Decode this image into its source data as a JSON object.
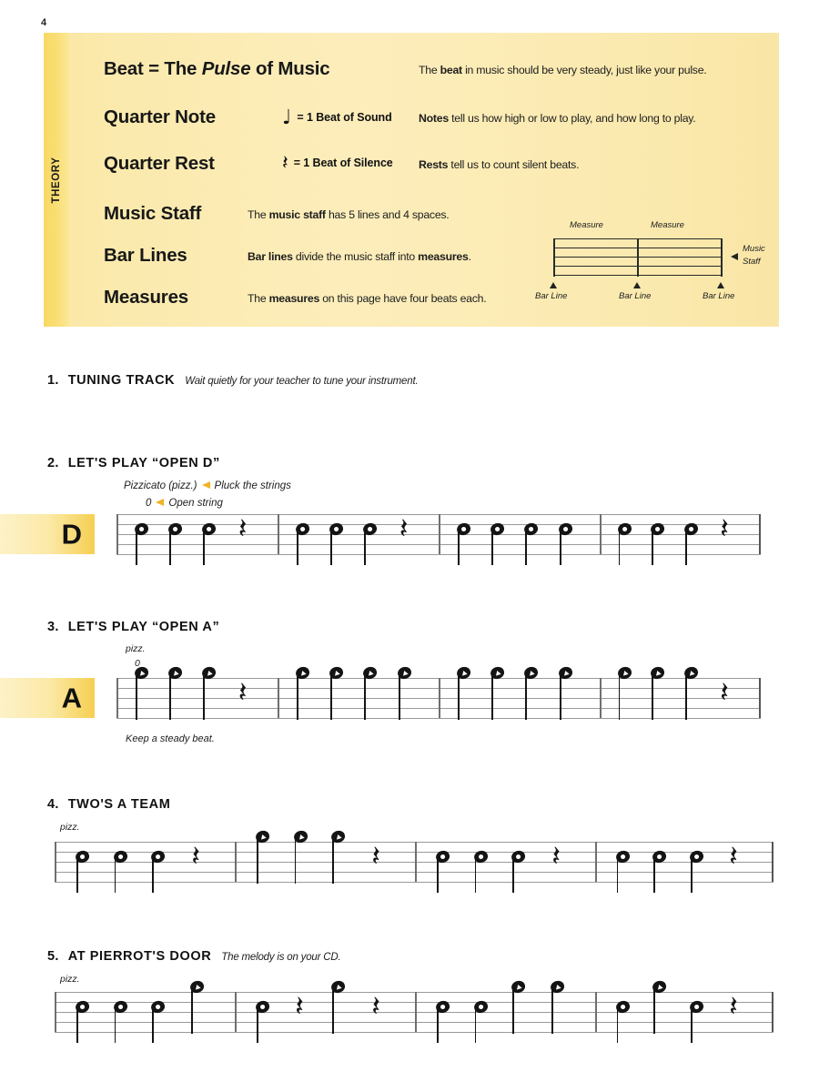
{
  "page": {
    "number": "4",
    "theory_tab_label": "THEORY"
  },
  "theory": {
    "rows": [
      {
        "term": "Beat = The ",
        "term_italic": "Pulse",
        "term_tail": " of Music",
        "symbol_glyph": "",
        "symbol_text": "",
        "desc_pre": "The ",
        "desc_bold": "beat",
        "desc_post": " in music should be very steady, just like your pulse."
      },
      {
        "term": "Quarter Note",
        "term_italic": "",
        "term_tail": "",
        "symbol_glyph": "♩",
        "symbol_text": "= 1 Beat of Sound",
        "desc_pre": "",
        "desc_bold": "Notes",
        "desc_post": " tell us how high or low to play, and how long to play."
      },
      {
        "term": "Quarter Rest",
        "term_italic": "",
        "term_tail": "",
        "symbol_glyph": "𝄽",
        "symbol_text": "= 1 Beat of Silence",
        "desc_pre": "",
        "desc_bold": "Rests",
        "desc_post": " tell us to count silent beats."
      },
      {
        "term": "Music Staff",
        "term_italic": "",
        "term_tail": "",
        "symbol_glyph": "",
        "symbol_text": "",
        "desc_pre": "The ",
        "desc_bold": "music staff",
        "desc_post": " has 5 lines and 4 spaces."
      },
      {
        "term": "Bar Lines",
        "term_italic": "",
        "term_tail": "",
        "symbol_glyph": "",
        "symbol_text": "",
        "desc_pre": "",
        "desc_bold": "Bar lines",
        "desc_post2_bold": "measures",
        "desc_post": " divide the music staff into "
      },
      {
        "term": "Measures",
        "term_italic": "",
        "term_tail": "",
        "symbol_glyph": "",
        "symbol_text": "",
        "desc_pre": "The ",
        "desc_bold": "measures",
        "desc_post": " on this page have four beats each."
      }
    ],
    "diagram": {
      "measure_label_left": "Measure",
      "measure_label_right": "Measure",
      "barline_labels": [
        "Bar Line",
        "Bar Line",
        "Bar Line"
      ],
      "staff_label_line1": "Music",
      "staff_label_line2": "Staff"
    }
  },
  "exercises": [
    {
      "number": "1.",
      "title": "TUNING TRACK",
      "subtitle": "Wait quietly for your teacher to tune your instrument."
    },
    {
      "number": "2.",
      "title": "LET'S PLAY “OPEN D”",
      "subtitle": "",
      "badge_letter": "D",
      "anno_pizz": "Pizzicato (pizz.)",
      "anno_pizz_tail": "Pluck the strings",
      "anno_open": "0",
      "anno_open_tail": "Open string",
      "below_note": ""
    },
    {
      "number": "3.",
      "title": "LET'S PLAY “OPEN A”",
      "subtitle": "",
      "badge_letter": "A",
      "anno_pizz": "pizz.",
      "anno_open": "0",
      "below_note": "Keep a steady beat."
    },
    {
      "number": "4.",
      "title": "TWO'S A TEAM",
      "subtitle": "",
      "anno_pizz": "pizz."
    },
    {
      "number": "5.",
      "title": "AT PIERROT'S DOOR",
      "subtitle": "The melody is on your CD.",
      "anno_pizz": "pizz."
    }
  ],
  "music": {
    "rest_glyph": "𝄽",
    "systems": [
      {
        "id": "ex2-system",
        "measures": [
          [
            "D",
            "D",
            "D",
            "R"
          ],
          [
            "D",
            "D",
            "D",
            "R"
          ],
          [
            "D",
            "D",
            "D",
            "D"
          ],
          [
            "D",
            "D",
            "D",
            "R"
          ]
        ]
      },
      {
        "id": "ex3-system",
        "measures": [
          [
            "A",
            "A",
            "A",
            "R"
          ],
          [
            "A",
            "A",
            "A",
            "A"
          ],
          [
            "A",
            "A",
            "A",
            "A"
          ],
          [
            "A",
            "A",
            "A",
            "R"
          ]
        ]
      },
      {
        "id": "ex4-system",
        "measures": [
          [
            "D",
            "D",
            "D",
            "R"
          ],
          [
            "A",
            "A",
            "A",
            "R"
          ],
          [
            "D",
            "D",
            "D",
            "R"
          ],
          [
            "D",
            "D",
            "D",
            "R"
          ]
        ]
      },
      {
        "id": "ex5-system",
        "measures": [
          [
            "D",
            "D",
            "D",
            "A"
          ],
          [
            "D",
            "R",
            "A",
            "R"
          ],
          [
            "D",
            "D",
            "A",
            "A"
          ],
          [
            "D",
            "A",
            "D",
            "R"
          ]
        ]
      }
    ]
  },
  "colors": {
    "theory_bg": "#fbeab0",
    "theory_tab": "#f7d964",
    "badge_accent": "#f6cf52",
    "arrow_yellow": "#f0b323",
    "staff_line": "#9a9a9a",
    "ink": "#141414"
  }
}
